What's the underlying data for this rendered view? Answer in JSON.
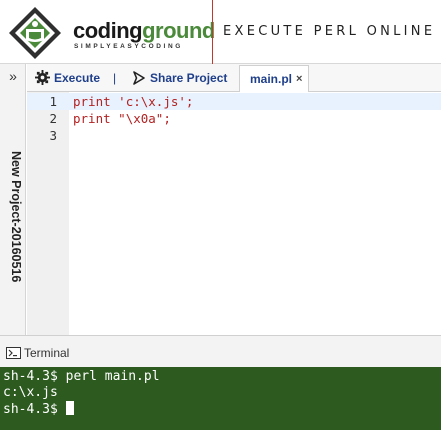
{
  "header": {
    "brand_part1": "coding",
    "brand_part2": "ground",
    "tagline": "SIMPLYEASYCODING",
    "title": "EXECUTE PERL ONLINE"
  },
  "sidebar": {
    "collapse_icon": "double-chevron-right-icon",
    "project_name": "New Project-20160516"
  },
  "toolbar": {
    "execute_label": "Execute",
    "separator": "|",
    "share_label": "Share Project",
    "tab_label": "main.pl",
    "tab_close": "×"
  },
  "editor": {
    "lines": [
      {
        "num": "1",
        "keyword": "print",
        "rest": " 'c:\\x.js';"
      },
      {
        "num": "2",
        "keyword": "print",
        "rest": " \"\\x0a\";"
      },
      {
        "num": "3",
        "keyword": "",
        "rest": ""
      }
    ]
  },
  "terminal": {
    "label": "Terminal",
    "lines": [
      "sh-4.3$ perl main.pl",
      "c:\\x.js",
      "sh-4.3$ "
    ]
  },
  "colors": {
    "terminal_bg": "#2c5a1f",
    "link": "#1f3f8a",
    "brand_green": "#4a8a3a",
    "accent_red": "#c0392b"
  }
}
